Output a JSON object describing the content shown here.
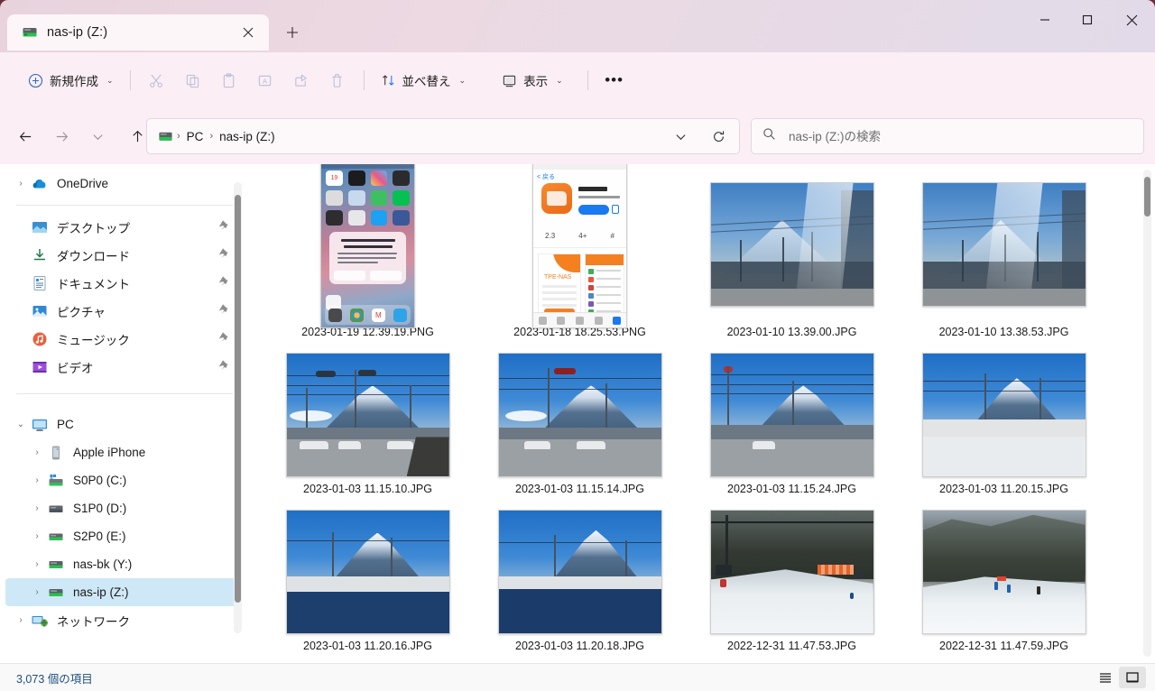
{
  "window": {
    "title": "nas-ip (Z:)",
    "accent_titlebar": "#e8d3dd",
    "controls": {
      "minimize": "–",
      "maximize": "□",
      "close": "✕"
    }
  },
  "tabs": {
    "items": [
      {
        "label": "nas-ip (Z:)",
        "icon": "network-drive-icon",
        "active": true,
        "close_label": "✕"
      }
    ],
    "new_tab_label": "+"
  },
  "toolbar": {
    "new_label": "新規作成",
    "cut_label": "切り取り",
    "copy_label": "コピー",
    "paste_label": "貼り付け",
    "rename_label": "名前の変更",
    "share_label": "共有",
    "delete_label": "削除",
    "sort_label": "並べ替え",
    "view_label": "表示",
    "more_label": "•••",
    "chevron": "⌄"
  },
  "navigation": {
    "back_label": "←",
    "forward_label": "→",
    "recent_label": "⌄",
    "up_label": "↑",
    "refresh_label": "⟳",
    "breadcrumb_dropdown": "⌄"
  },
  "breadcrumb": {
    "icon": "network-drive-icon",
    "separator": "›",
    "items": [
      "PC",
      "nas-ip (Z:)"
    ]
  },
  "search": {
    "placeholder": "nas-ip (Z:)の検索",
    "value": "",
    "icon": "search-icon"
  },
  "sidebar": {
    "onedrive": {
      "label": "OneDrive",
      "icon": "onedrive-cloud-icon",
      "twisty": "›"
    },
    "quick_access": [
      {
        "label": "デスクトップ",
        "icon": "desktop-icon",
        "pinned": true
      },
      {
        "label": "ダウンロード",
        "icon": "downloads-icon",
        "pinned": true
      },
      {
        "label": "ドキュメント",
        "icon": "documents-icon",
        "pinned": true
      },
      {
        "label": "ピクチャ",
        "icon": "pictures-icon",
        "pinned": true
      },
      {
        "label": "ミュージック",
        "icon": "music-icon",
        "pinned": true
      },
      {
        "label": "ビデオ",
        "icon": "videos-icon",
        "pinned": true
      }
    ],
    "pc": {
      "label": "PC",
      "icon": "this-pc-icon",
      "twisty": "⌄"
    },
    "pc_children": [
      {
        "label": "Apple iPhone",
        "icon": "phone-icon",
        "twisty": "›",
        "selected": false
      },
      {
        "label": "S0P0 (C:)",
        "icon": "windows-drive-icon",
        "twisty": "›",
        "selected": false
      },
      {
        "label": "S1P0 (D:)",
        "icon": "drive-icon",
        "twisty": "›",
        "selected": false
      },
      {
        "label": "S2P0 (E:)",
        "icon": "drive-icon",
        "twisty": "›",
        "selected": false
      },
      {
        "label": "nas-bk (Y:)",
        "icon": "network-drive-icon",
        "twisty": "›",
        "selected": false
      },
      {
        "label": "nas-ip (Z:)",
        "icon": "network-drive-icon",
        "twisty": "›",
        "selected": true
      }
    ],
    "network": {
      "label": "ネットワーク",
      "icon": "network-icon",
      "twisty": "›"
    },
    "pin_glyph": "📌"
  },
  "files": [
    {
      "name": "2023-01-19 12.39.19.PNG",
      "orientation": "portrait",
      "art": "ios-home"
    },
    {
      "name": "2023-01-18 18.25.53.PNG",
      "orientation": "portrait",
      "art": "appstore"
    },
    {
      "name": "2023-01-10 13.39.00.JPG",
      "orientation": "landscape",
      "art": "fuji-hazy"
    },
    {
      "name": "2023-01-10 13.38.53.JPG",
      "orientation": "landscape",
      "art": "fuji-hazy"
    },
    {
      "name": "2023-01-03 11.15.10.JPG",
      "orientation": "landscape",
      "art": "fuji-clear"
    },
    {
      "name": "2023-01-03 11.15.14.JPG",
      "orientation": "landscape",
      "art": "fuji-clear"
    },
    {
      "name": "2023-01-03 11.15.24.JPG",
      "orientation": "landscape",
      "art": "fuji-clear"
    },
    {
      "name": "2023-01-03 11.20.15.JPG",
      "orientation": "landscape",
      "art": "fuji-clear"
    },
    {
      "name": "2023-01-03 11.20.16.JPG",
      "orientation": "landscape",
      "art": "fuji-clear"
    },
    {
      "name": "2023-01-03 11.20.18.JPG",
      "orientation": "landscape",
      "art": "fuji-clear"
    },
    {
      "name": "2022-12-31 11.47.53.JPG",
      "orientation": "landscape",
      "art": "ski"
    },
    {
      "name": "2022-12-31 11.47.59.JPG",
      "orientation": "landscape",
      "art": "ski2"
    }
  ],
  "appstore_thumb": {
    "app_name": "Qfile",
    "developer": "QNAP Systems, Inc.",
    "rating": "2.3",
    "age": "4+",
    "screenshot_title": "TPE-NAS"
  },
  "ios_thumb": {
    "calendar_day": "19"
  },
  "statusbar": {
    "item_count_text": "3,073 個の項目",
    "details_view_label": "詳細",
    "large_icons_view_label": "大アイコン"
  }
}
